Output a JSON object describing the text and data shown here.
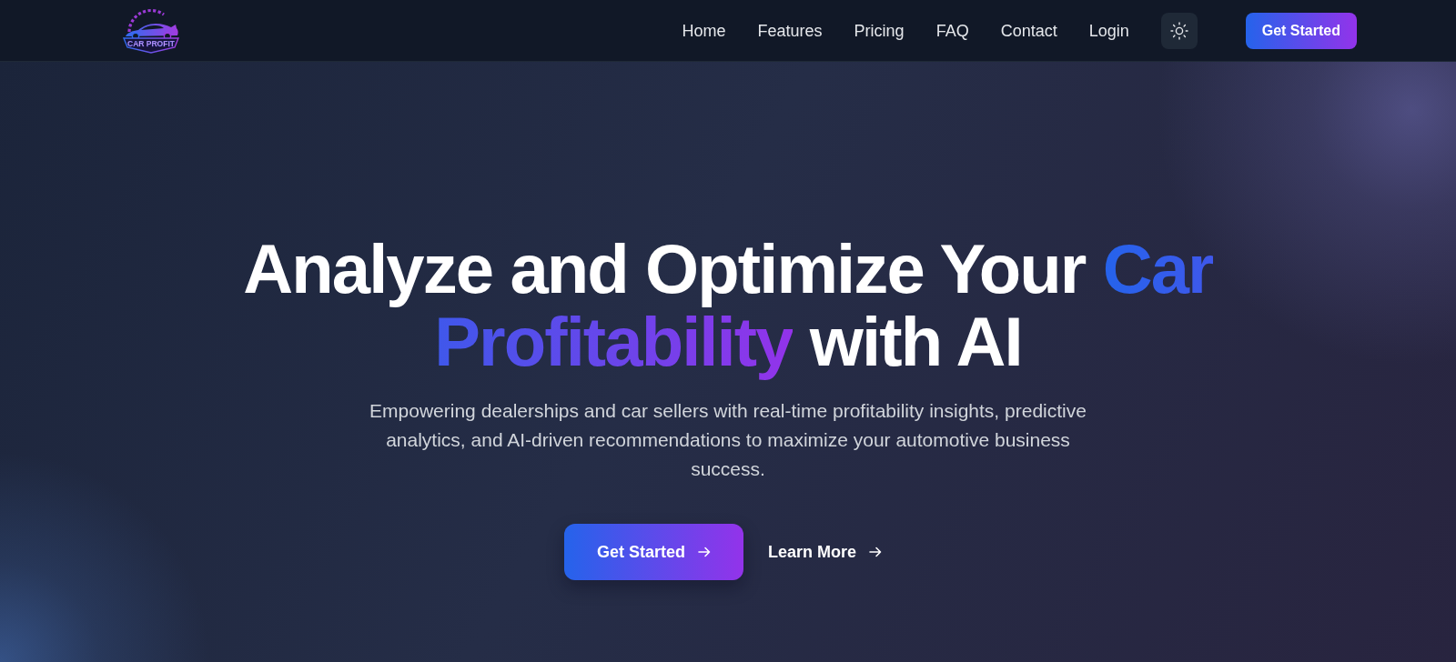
{
  "logo": {
    "text": "CAR PROFIT"
  },
  "nav": {
    "links": [
      {
        "label": "Home"
      },
      {
        "label": "Features"
      },
      {
        "label": "Pricing"
      },
      {
        "label": "FAQ"
      },
      {
        "label": "Contact"
      },
      {
        "label": "Login"
      }
    ],
    "cta": "Get Started"
  },
  "hero": {
    "headline": {
      "lead": "Analyze and Optimize Your",
      "highlight": "Car Profitability",
      "tail": "with AI"
    },
    "subtitle": "Empowering dealerships and car sellers with real-time profitability insights, predictive analytics, and AI-driven recommendations to maximize your automotive business success.",
    "buttons": [
      {
        "label": "Get Started",
        "kind": "primary"
      },
      {
        "label": "Learn More",
        "kind": "link"
      }
    ]
  }
}
